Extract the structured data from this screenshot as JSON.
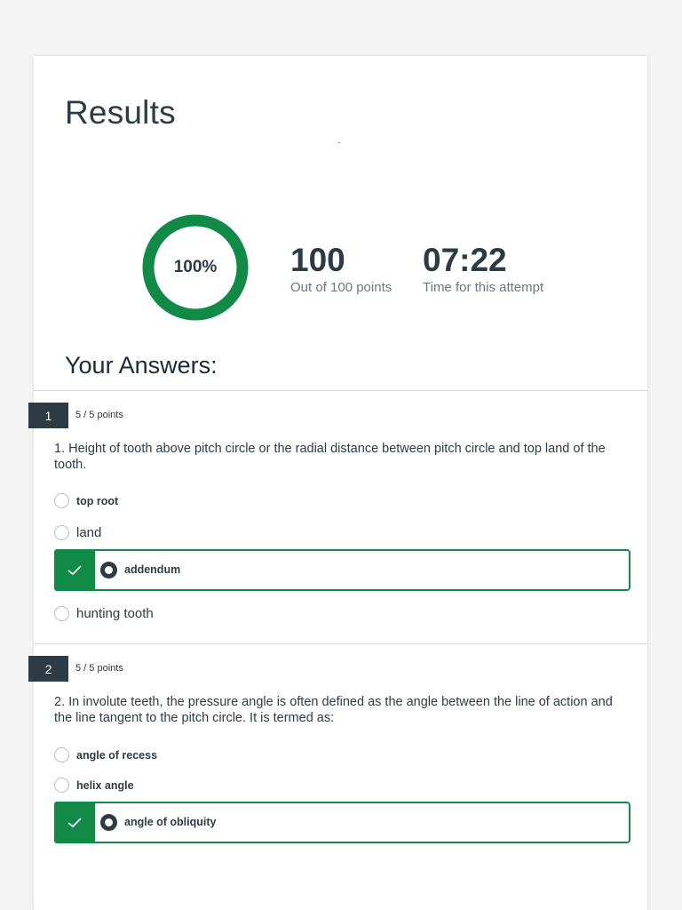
{
  "results": {
    "title": "Results",
    "score_percent": "100%",
    "score_fraction": 1.0,
    "points": "100",
    "points_label": "Out of 100 points",
    "time": "07:22",
    "time_label": "Time for this attempt",
    "accent_color": "#128a47"
  },
  "answers_title": "Your Answers:",
  "questions": [
    {
      "number": "1",
      "points": "5 / 5 points",
      "text": "1. Height of tooth above pitch circle or the radial distance between pitch circle and top land of the tooth.",
      "options": [
        "top root",
        "land",
        "addendum",
        "hunting tooth"
      ],
      "selected": "addendum"
    },
    {
      "number": "2",
      "points": "5 / 5 points",
      "text": "2.  In involute teeth, the pressure angle is often defined as the angle between the line of action and the line tangent to the pitch circle.  It is termed as:",
      "options": [
        "angle of recess",
        "helix angle",
        "angle of obliquity"
      ],
      "selected": "angle of obliquity"
    }
  ]
}
